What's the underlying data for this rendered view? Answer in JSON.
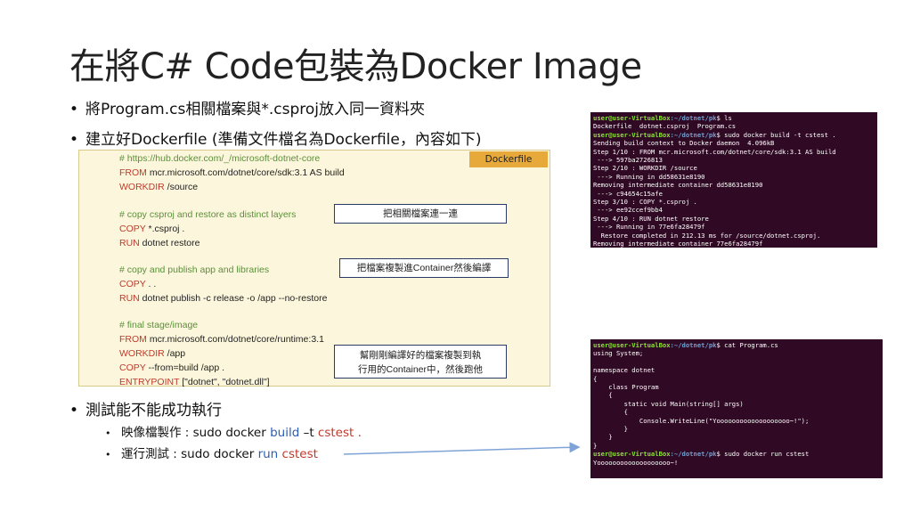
{
  "title": "在將C# Code包裝為Docker Image",
  "bullets": {
    "b1": "將Program.cs相關檔案與*.csproj放入同一資料夾",
    "b2": "建立好Dockerfile (準備文件檔名為Dockerfile，內容如下)",
    "b3": "測試能不能成功執行"
  },
  "sub_bullets": {
    "s1_prefix": "映像檔製作 : sudo docker ",
    "s1_build": "build",
    "s1_mid": " –t ",
    "s1_name": "cstest .",
    "s2_prefix": "運行測試 : sudo docker ",
    "s2_run": "run",
    "s2_name": " cstest"
  },
  "dockerfile": {
    "tag": "Dockerfile",
    "lines": [
      {
        "kw": "",
        "text": "# https://hub.docker.com/_/microsoft-dotnet-core",
        "comment": true
      },
      {
        "kw": "FROM",
        "text": " mcr.microsoft.com/dotnet/core/sdk:3.1  AS build"
      },
      {
        "kw": "WORKDIR",
        "text": " /source"
      },
      {
        "kw": "",
        "text": "# copy csproj and restore as distinct layers",
        "comment": true
      },
      {
        "kw": "COPY",
        "text": " *.csproj ."
      },
      {
        "kw": "RUN",
        "text": " dotnet restore"
      },
      {
        "kw": "",
        "text": "# copy and publish app and libraries",
        "comment": true
      },
      {
        "kw": "COPY",
        "text": " . ."
      },
      {
        "kw": "RUN",
        "text": " dotnet publish -c release -o /app --no-restore"
      },
      {
        "kw": "",
        "text": "# final stage/image",
        "comment": true
      },
      {
        "kw": "FROM",
        "text": " mcr.microsoft.com/dotnet/core/runtime:3.1"
      },
      {
        "kw": "WORKDIR",
        "text": " /app"
      },
      {
        "kw": "COPY",
        "text": " --from=build /app ."
      },
      {
        "kw": "ENTRYPOINT",
        "text": " [\"dotnet\", \"dotnet.dll\"]"
      }
    ],
    "notes": {
      "n1": "把相關檔案連一連",
      "n2": "把檔案複製進Container然後編譯",
      "n3a": "幫剛剛編譯好的檔案複製到執",
      "n3b": "行用的Container中，然後跑他"
    }
  },
  "terminal1": {
    "lines": [
      {
        "user": "user@user-VirtualBox",
        "path": ":~/dotnet/pk",
        "cmd": "$ ls"
      },
      {
        "text": "Dockerfile  dotnet.csproj  Program.cs"
      },
      {
        "user": "user@user-VirtualBox",
        "path": ":~/dotnet/pk",
        "cmd": "$ sudo docker build -t cstest ."
      },
      {
        "text": "Sending build context to Docker daemon  4.096kB"
      },
      {
        "text": "Step 1/10 : FROM mcr.microsoft.com/dotnet/core/sdk:3.1 AS build"
      },
      {
        "text": " ---> 597ba2726813"
      },
      {
        "text": "Step 2/10 : WORKDIR /source"
      },
      {
        "text": " ---> Running in dd58631e8190"
      },
      {
        "text": "Removing intermediate container dd58631e8190"
      },
      {
        "text": " ---> c94654c15afe"
      },
      {
        "text": "Step 3/10 : COPY *.csproj ."
      },
      {
        "text": " ---> ee92ccef9bb4"
      },
      {
        "text": "Step 4/10 : RUN dotnet restore"
      },
      {
        "text": " ---> Running in 77e6fa28479f"
      },
      {
        "text": "  Restore completed in 212.13 ms for /source/dotnet.csproj."
      },
      {
        "text": "Removing intermediate container 77e6fa28479f"
      }
    ]
  },
  "terminal2": {
    "lines": [
      {
        "user": "user@user-VirtualBox",
        "path": ":~/dotnet/pk",
        "cmd": "$ cat Program.cs"
      },
      {
        "text": "using System;"
      },
      {
        "text": ""
      },
      {
        "text": "namespace dotnet"
      },
      {
        "text": "{"
      },
      {
        "text": "    class Program"
      },
      {
        "text": "    {"
      },
      {
        "text": "        static void Main(string[] args)"
      },
      {
        "text": "        {"
      },
      {
        "text": "            Console.WriteLine(\"Yooooooooooooooooooo~!\");"
      },
      {
        "text": "        }"
      },
      {
        "text": "    }"
      },
      {
        "text": "}"
      },
      {
        "user": "user@user-VirtualBox",
        "path": ":~/dotnet/pk",
        "cmd": "$ sudo docker run cstest"
      },
      {
        "text": "Yooooooooooooooooooo~!"
      }
    ]
  }
}
